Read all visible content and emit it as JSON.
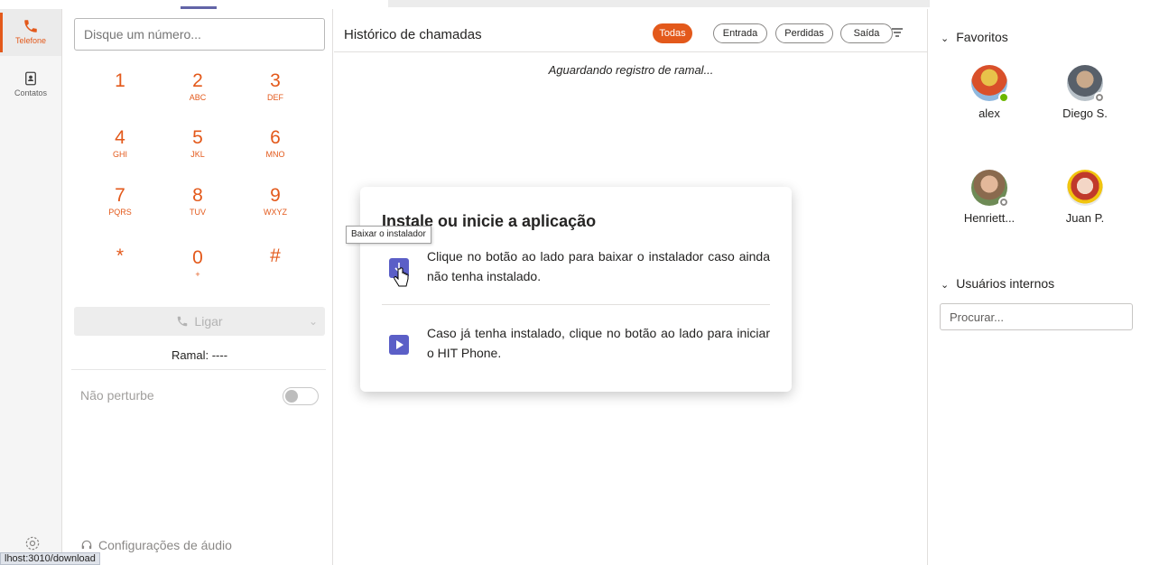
{
  "rail": {
    "phone_label": "Telefone",
    "contacts_label": "Contatos"
  },
  "dialer": {
    "input_placeholder": "Disque um número...",
    "keys": [
      {
        "num": "1",
        "sub": ""
      },
      {
        "num": "2",
        "sub": "ABC"
      },
      {
        "num": "3",
        "sub": "DEF"
      },
      {
        "num": "4",
        "sub": "GHI"
      },
      {
        "num": "5",
        "sub": "JKL"
      },
      {
        "num": "6",
        "sub": "MNO"
      },
      {
        "num": "7",
        "sub": "PQRS"
      },
      {
        "num": "8",
        "sub": "TUV"
      },
      {
        "num": "9",
        "sub": "WXYZ"
      },
      {
        "num": "*",
        "sub": ""
      },
      {
        "num": "0",
        "sub": "+"
      },
      {
        "num": "#",
        "sub": ""
      }
    ],
    "call_label": "Ligar",
    "ramal": "Ramal: ----",
    "dnd_label": "Não perturbe",
    "audio_settings": "Configurações de áudio"
  },
  "history": {
    "title": "Histórico de chamadas",
    "filters": [
      "Todas",
      "Entrada",
      "Perdidas",
      "Saída"
    ],
    "active_filter": "Todas",
    "waiting": "Aguardando registro de ramal..."
  },
  "favorites": {
    "title": "Favoritos",
    "people": [
      {
        "name": "alex",
        "status": "online"
      },
      {
        "name": "Diego S.",
        "status": "offline"
      },
      {
        "name": "Henriett...",
        "status": "offline"
      },
      {
        "name": "Juan P.",
        "status": ""
      }
    ]
  },
  "internal_users": {
    "title": "Usuários internos",
    "search_placeholder": "Procurar..."
  },
  "modal": {
    "title": "Instale ou inicie a aplicação",
    "download_text": "Clique no botão ao lado para baixar o instalador caso ainda não tenha instalado.",
    "launch_text": "Caso já tenha instalado, clique no botão ao lado para iniciar o HIT Phone."
  },
  "tooltip": "Baixar o instalador",
  "statusbar": "lhost:3010/download",
  "colors": {
    "accent": "#e3591b",
    "brand": "#5b5fc7"
  }
}
